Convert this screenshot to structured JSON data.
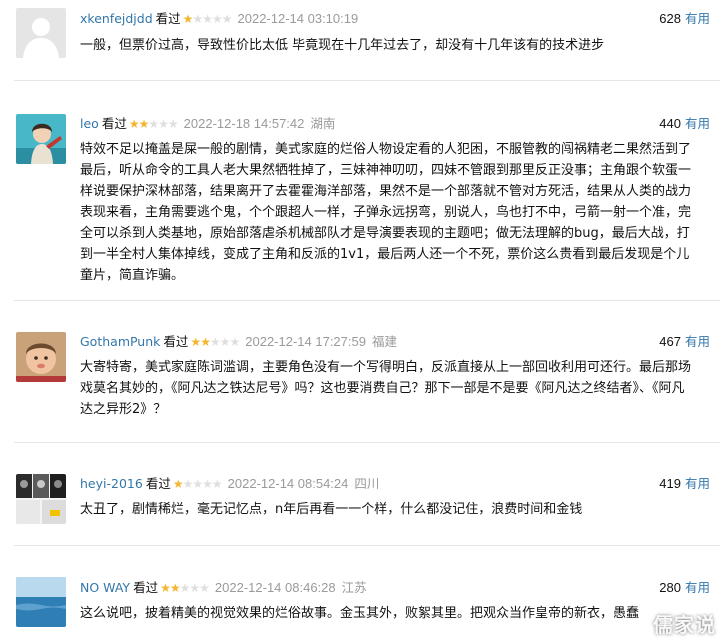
{
  "labels": {
    "seen": "看过",
    "useful": "有用"
  },
  "reviews": [
    {
      "user": "xkenfejdjdd",
      "rating": 1,
      "time": "2022-12-14 03:10:19",
      "location": "",
      "votes": "628",
      "avatar": "default-avatar",
      "text": "一般，但票价过高，导致性价比太低 毕竟现在十几年过去了，却没有十几年该有的技术进步"
    },
    {
      "user": "leo",
      "rating": 2,
      "time": "2022-12-18 14:57:42",
      "location": "湖南",
      "votes": "440",
      "avatar": "illustration-avatar",
      "text": "特效不足以掩盖是屎一般的剧情，美式家庭的烂俗人物设定看的人犯困，不服管教的闯祸精老二果然活到了最后，听从命令的工具人老大果然牺牲掉了，三妹神神叨叨，四妹不管跟到那里反正没事；主角跟个软蛋一样说要保护深林部落，结果离开了去霍霍海洋部落，果然不是一个部落就不管对方死活，结果从人类的战力表现来看，主角需要逃个鬼，个个跟超人一样，子弹永远拐弯，别说人，鸟也打不中，弓箭一射一个准，完全可以杀到人类基地，原始部落虐杀机械部队才是导演要表现的主题吧；做无法理解的bug，最后大战，打到一半全村人集体掉线，变成了主角和反派的1v1，最后两人还一个不死，票价这么贵看到最后发现是个儿童片，简直诈骗。"
    },
    {
      "user": "GothamPunk",
      "rating": 2,
      "time": "2022-12-14 17:27:59",
      "location": "福建",
      "votes": "467",
      "avatar": "baby-photo-avatar",
      "text": "大寄特寄，美式家庭陈词滥调，主要角色没有一个写得明白，反派直接从上一部回收利用可还行。最后那场戏莫名其妙的，《阿凡达之铁达尼号》吗？这也要消费自己？那下一部是不是要《阿凡达之终结者》、《阿凡达之异形2》？"
    },
    {
      "user": "heyi-2016",
      "rating": 1,
      "time": "2022-12-14 08:54:24",
      "location": "四川",
      "votes": "419",
      "avatar": "collage-avatar",
      "text": "太丑了，剧情稀烂，毫无记忆点，n年后再看一一个样，什么都没记住，浪费时间和金钱"
    },
    {
      "user": "NO WAY",
      "rating": 2,
      "time": "2022-12-14 08:46:28",
      "location": "江苏",
      "votes": "280",
      "avatar": "sea-photo-avatar",
      "text": "这么说吧，披着精美的视觉效果的烂俗故事。金玉其外，败絮其里。把观众当作皇帝的新衣，愚蠢"
    }
  ],
  "watermark": "儒家说",
  "colors": {
    "link": "#3377aa",
    "star_on": "#f4b631",
    "star_off": "#dfdfdf",
    "meta": "#9a9a9a"
  }
}
